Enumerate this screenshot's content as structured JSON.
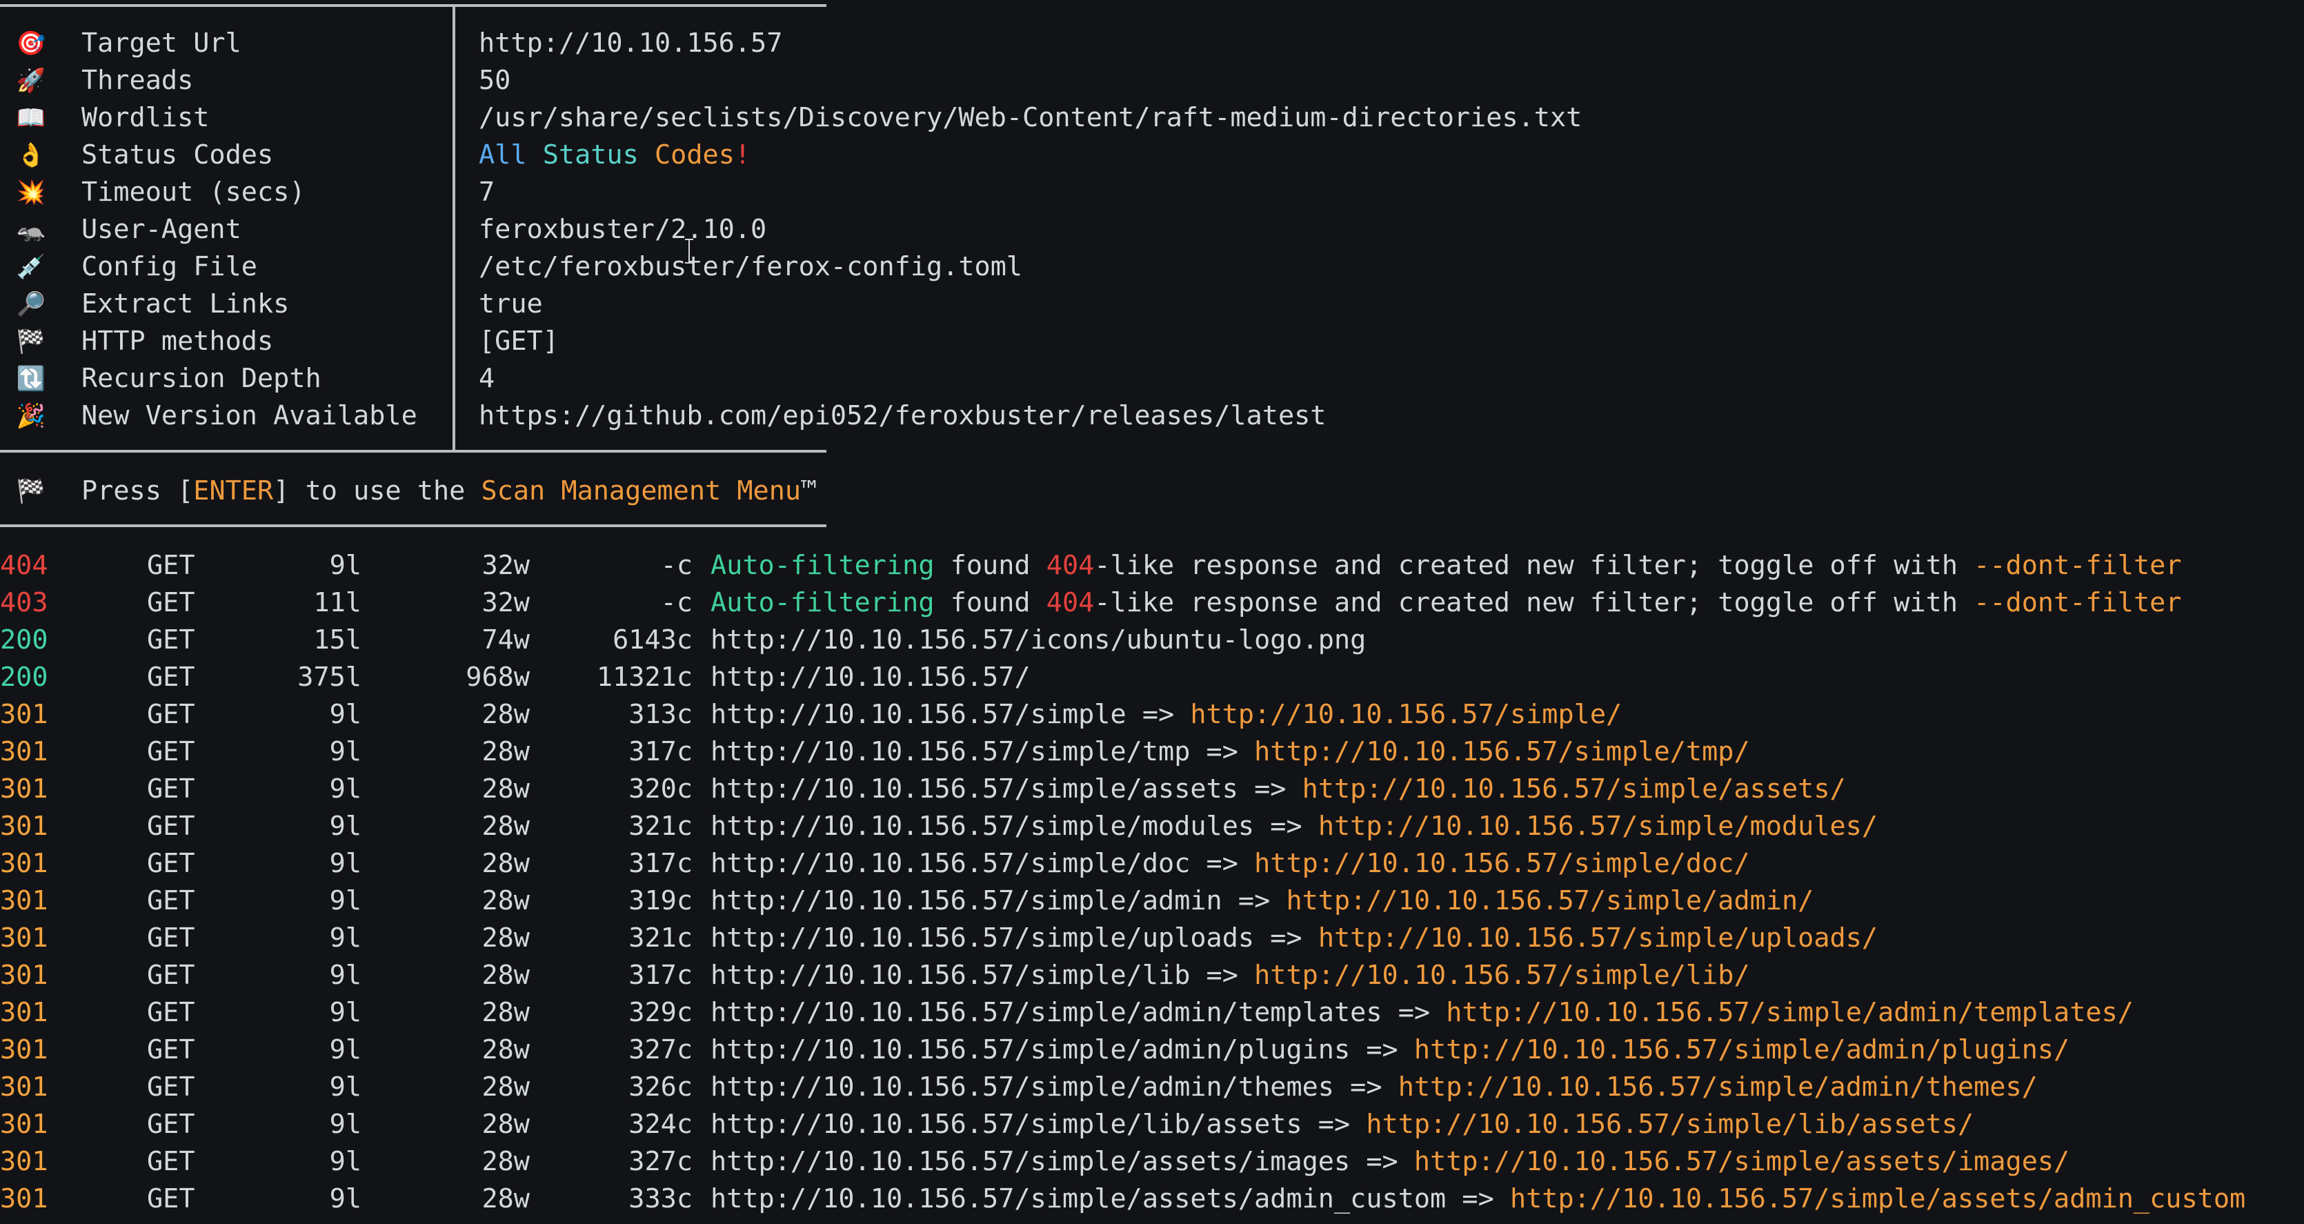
{
  "config": [
    {
      "icon": "target-icon",
      "glyph": "🎯",
      "key": "Target Url",
      "value": "http://10.10.156.57"
    },
    {
      "icon": "rocket-icon",
      "glyph": "🚀",
      "key": "Threads",
      "value": "50"
    },
    {
      "icon": "book-icon",
      "glyph": "📖",
      "key": "Wordlist",
      "value": "/usr/share/seclists/Discovery/Web-Content/raft-medium-directories.txt"
    },
    {
      "icon": "ok-hand-icon",
      "glyph": "👌",
      "key": "Status Codes",
      "value_parts": [
        {
          "text": "All ",
          "color": "blue"
        },
        {
          "text": "Status ",
          "color": "cyan"
        },
        {
          "text": "Codes",
          "color": "orange"
        },
        {
          "text": "!",
          "color": "red"
        }
      ]
    },
    {
      "icon": "collision-icon",
      "glyph": "💥",
      "key": "Timeout (secs)",
      "value": "7"
    },
    {
      "icon": "badger-icon",
      "glyph": "🦡",
      "key": "User-Agent",
      "value": "feroxbuster/2.10.0"
    },
    {
      "icon": "syringe-icon",
      "glyph": "💉",
      "key": "Config File",
      "value": "/etc/feroxbuster/ferox-config.toml"
    },
    {
      "icon": "magnifier-icon",
      "glyph": "🔎",
      "key": "Extract Links",
      "value": "true"
    },
    {
      "icon": "checkered-flag-icon",
      "glyph": "🏁",
      "key": "HTTP methods",
      "value": "[GET]"
    },
    {
      "icon": "repeat-icon",
      "glyph": "🔃",
      "key": "Recursion Depth",
      "value": "4"
    },
    {
      "icon": "party-popper-icon",
      "glyph": "🎉",
      "key": "New Version Available",
      "value": "https://github.com/epi052/feroxbuster/releases/latest"
    }
  ],
  "prompt": {
    "icon": "checkered-flag-icon",
    "glyph": "🏁",
    "parts": [
      {
        "text": "Press [",
        "color": ""
      },
      {
        "text": "ENTER",
        "color": "orange"
      },
      {
        "text": "] to use the ",
        "color": ""
      },
      {
        "text": "Scan Management Menu",
        "color": "orange"
      },
      {
        "text": "™",
        "color": ""
      }
    ]
  },
  "results": [
    {
      "status": "404",
      "method": "GET",
      "lines": "9l",
      "words": "32w",
      "chars": "-c",
      "filter": true
    },
    {
      "status": "403",
      "method": "GET",
      "lines": "11l",
      "words": "32w",
      "chars": "-c",
      "filter": true
    },
    {
      "status": "200",
      "method": "GET",
      "lines": "15l",
      "words": "74w",
      "chars": "6143c",
      "url": "http://10.10.156.57/icons/ubuntu-logo.png"
    },
    {
      "status": "200",
      "method": "GET",
      "lines": "375l",
      "words": "968w",
      "chars": "11321c",
      "url": "http://10.10.156.57/"
    },
    {
      "status": "301",
      "method": "GET",
      "lines": "9l",
      "words": "28w",
      "chars": "313c",
      "url": "http://10.10.156.57/simple",
      "redirect": "http://10.10.156.57/simple/"
    },
    {
      "status": "301",
      "method": "GET",
      "lines": "9l",
      "words": "28w",
      "chars": "317c",
      "url": "http://10.10.156.57/simple/tmp",
      "redirect": "http://10.10.156.57/simple/tmp/"
    },
    {
      "status": "301",
      "method": "GET",
      "lines": "9l",
      "words": "28w",
      "chars": "320c",
      "url": "http://10.10.156.57/simple/assets",
      "redirect": "http://10.10.156.57/simple/assets/"
    },
    {
      "status": "301",
      "method": "GET",
      "lines": "9l",
      "words": "28w",
      "chars": "321c",
      "url": "http://10.10.156.57/simple/modules",
      "redirect": "http://10.10.156.57/simple/modules/"
    },
    {
      "status": "301",
      "method": "GET",
      "lines": "9l",
      "words": "28w",
      "chars": "317c",
      "url": "http://10.10.156.57/simple/doc",
      "redirect": "http://10.10.156.57/simple/doc/"
    },
    {
      "status": "301",
      "method": "GET",
      "lines": "9l",
      "words": "28w",
      "chars": "319c",
      "url": "http://10.10.156.57/simple/admin",
      "redirect": "http://10.10.156.57/simple/admin/"
    },
    {
      "status": "301",
      "method": "GET",
      "lines": "9l",
      "words": "28w",
      "chars": "321c",
      "url": "http://10.10.156.57/simple/uploads",
      "redirect": "http://10.10.156.57/simple/uploads/"
    },
    {
      "status": "301",
      "method": "GET",
      "lines": "9l",
      "words": "28w",
      "chars": "317c",
      "url": "http://10.10.156.57/simple/lib",
      "redirect": "http://10.10.156.57/simple/lib/"
    },
    {
      "status": "301",
      "method": "GET",
      "lines": "9l",
      "words": "28w",
      "chars": "329c",
      "url": "http://10.10.156.57/simple/admin/templates",
      "redirect": "http://10.10.156.57/simple/admin/templates/"
    },
    {
      "status": "301",
      "method": "GET",
      "lines": "9l",
      "words": "28w",
      "chars": "327c",
      "url": "http://10.10.156.57/simple/admin/plugins",
      "redirect": "http://10.10.156.57/simple/admin/plugins/"
    },
    {
      "status": "301",
      "method": "GET",
      "lines": "9l",
      "words": "28w",
      "chars": "326c",
      "url": "http://10.10.156.57/simple/admin/themes",
      "redirect": "http://10.10.156.57/simple/admin/themes/"
    },
    {
      "status": "301",
      "method": "GET",
      "lines": "9l",
      "words": "28w",
      "chars": "324c",
      "url": "http://10.10.156.57/simple/lib/assets",
      "redirect": "http://10.10.156.57/simple/lib/assets/"
    },
    {
      "status": "301",
      "method": "GET",
      "lines": "9l",
      "words": "28w",
      "chars": "327c",
      "url": "http://10.10.156.57/simple/assets/images",
      "redirect": "http://10.10.156.57/simple/assets/images/"
    },
    {
      "status": "301",
      "method": "GET",
      "lines": "9l",
      "words": "28w",
      "chars": "333c",
      "url": "http://10.10.156.57/simple/assets/admin_custom",
      "redirect": "http://10.10.156.57/simple/assets/admin_custom"
    }
  ],
  "filter_message": {
    "part1": "Auto-filtering",
    "part2": " found ",
    "part3": "404",
    "part4": "-like response and created new filter; toggle off with ",
    "part5": "--dont-filter"
  },
  "arrow": " => "
}
